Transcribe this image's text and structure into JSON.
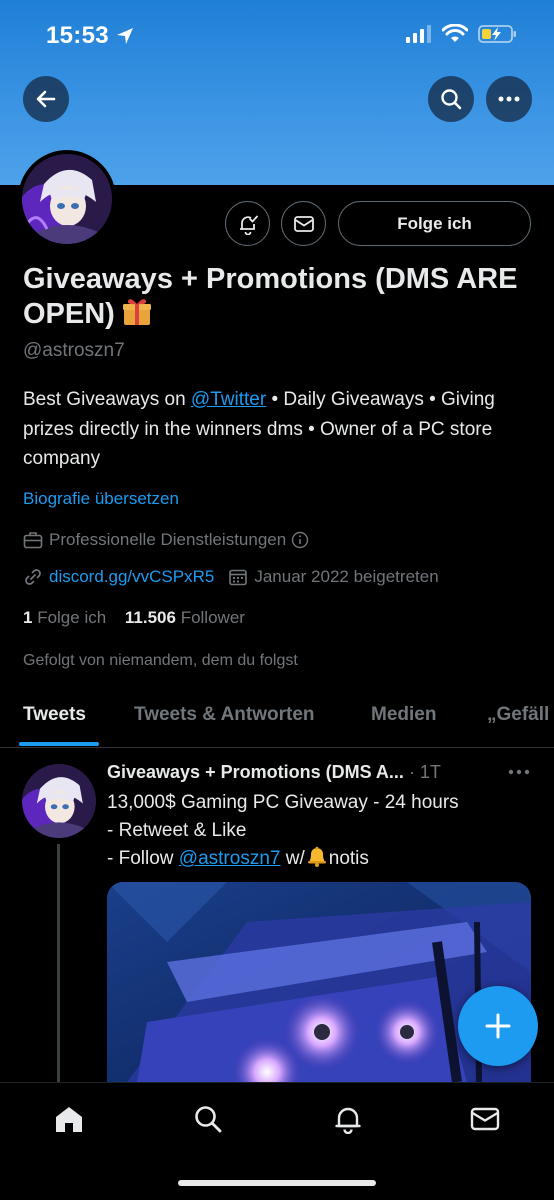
{
  "status_bar": {
    "time": "15:53"
  },
  "profile": {
    "display_name": "Giveaways + Promotions (DMS ARE OPEN)",
    "handle": "@astroszn7",
    "follow_button_label": "Folge ich",
    "bio": {
      "part1": "Best Giveaways on ",
      "mention": "@Twitter",
      "part2": " • Daily Giveaways • Giving prizes directly in the winners dms • Owner of a PC store company"
    },
    "translate_label": "Biografie übersetzen",
    "category": "Professionelle Dienstleistungen",
    "website": "discord.gg/vvCSPxR5",
    "joined": "Januar 2022 beigetreten",
    "following_count": "1",
    "following_label": " Folge ich",
    "followers_count": "11.506",
    "followers_label": " Follower",
    "followed_by": "Gefolgt von niemandem, dem du folgst"
  },
  "tabs": [
    {
      "label": "Tweets",
      "active": true
    },
    {
      "label": "Tweets & Antworten",
      "active": false
    },
    {
      "label": "Medien",
      "active": false
    },
    {
      "label": "„Gefäll",
      "active": false
    }
  ],
  "tweet": {
    "author_name": "Giveaways + Promotions (DMS A...",
    "time": " · 1T",
    "line1": "13,000$ Gaming PC Giveaway - 24 hours",
    "line2": "- Retweet & Like",
    "line3_prefix": "- Follow ",
    "line3_mention": "@astroszn7",
    "line3_mid": " w/",
    "line3_suffix": "notis"
  },
  "icons": {
    "back": "arrow-left-icon",
    "search": "search-icon",
    "more": "more-horizontal-icon",
    "notify": "bell-check-icon",
    "message": "envelope-icon",
    "gift": "gift-emoji",
    "bell_emoji": "bell-emoji",
    "briefcase": "briefcase-icon",
    "info": "info-icon",
    "link": "link-icon",
    "calendar": "calendar-icon",
    "compose": "plus-icon",
    "home": "home-icon",
    "notifications": "bell-icon",
    "messages": "envelope-icon"
  },
  "colors": {
    "accent": "#1d9bf0",
    "banner": "#3a93e3",
    "background": "#000000",
    "text_primary": "#e7e9ea",
    "text_secondary": "#71767b"
  }
}
